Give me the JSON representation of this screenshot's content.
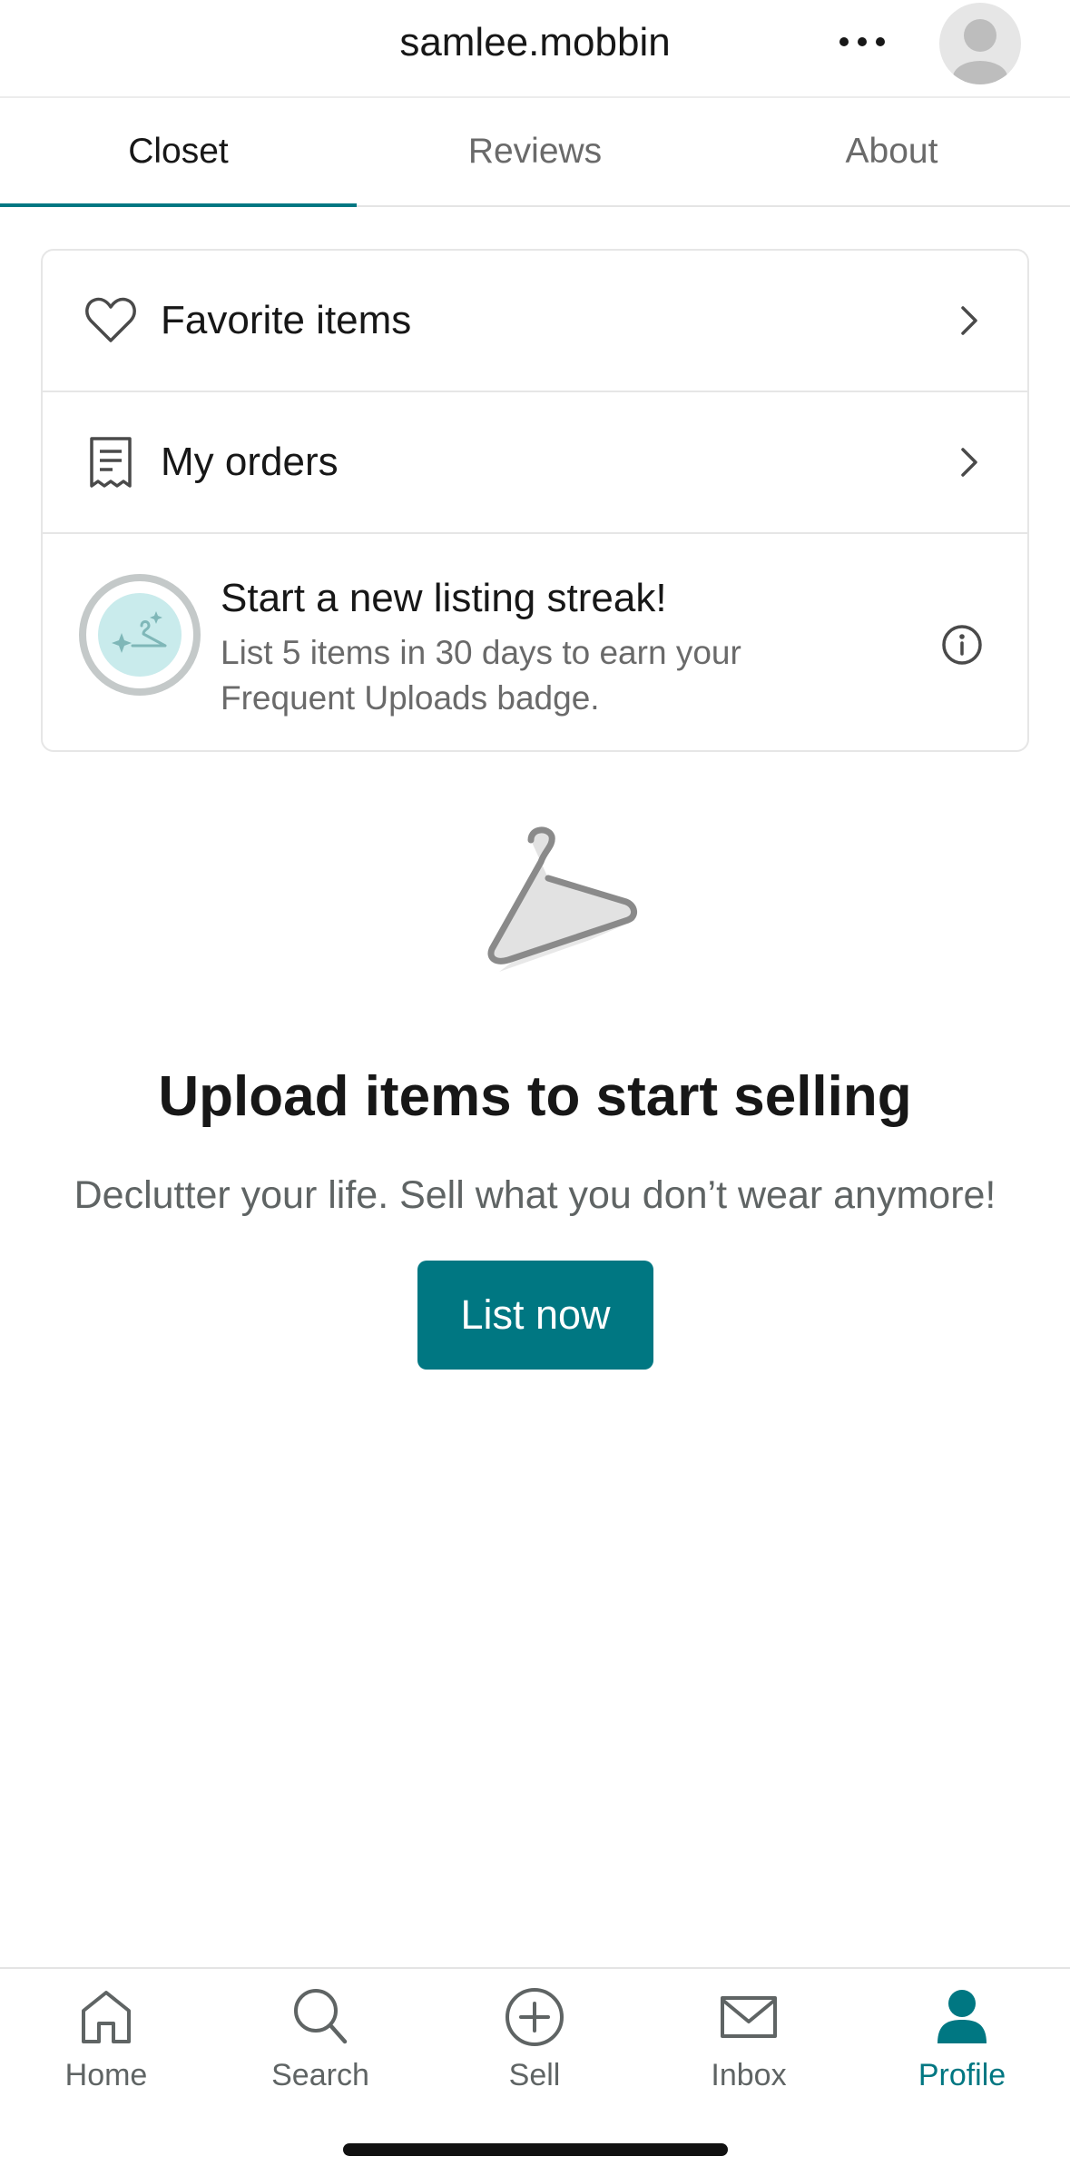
{
  "header": {
    "username": "samlee.mobbin"
  },
  "tabs": [
    {
      "label": "Closet",
      "active": true
    },
    {
      "label": "Reviews",
      "active": false
    },
    {
      "label": "About",
      "active": false
    }
  ],
  "menu": {
    "favorites_label": "Favorite items",
    "orders_label": "My orders"
  },
  "streak": {
    "title": "Start a new listing streak!",
    "description": "List 5 items in 30 days to earn your Frequent Uploads badge."
  },
  "empty_state": {
    "title": "Upload items to start selling",
    "subtitle": "Declutter your life. Sell what you don’t wear anymore!",
    "cta_label": "List now"
  },
  "bottom_nav": {
    "items": [
      {
        "label": "Home",
        "icon": "home-icon",
        "active": false
      },
      {
        "label": "Search",
        "icon": "search-icon",
        "active": false
      },
      {
        "label": "Sell",
        "icon": "plus-circle-icon",
        "active": false
      },
      {
        "label": "Inbox",
        "icon": "mail-icon",
        "active": false
      },
      {
        "label": "Profile",
        "icon": "person-icon",
        "active": true
      }
    ]
  },
  "colors": {
    "accent": "#007782",
    "text_primary": "#171717",
    "text_secondary": "#6a6a6a",
    "streak_bg": "#c9ebec"
  }
}
